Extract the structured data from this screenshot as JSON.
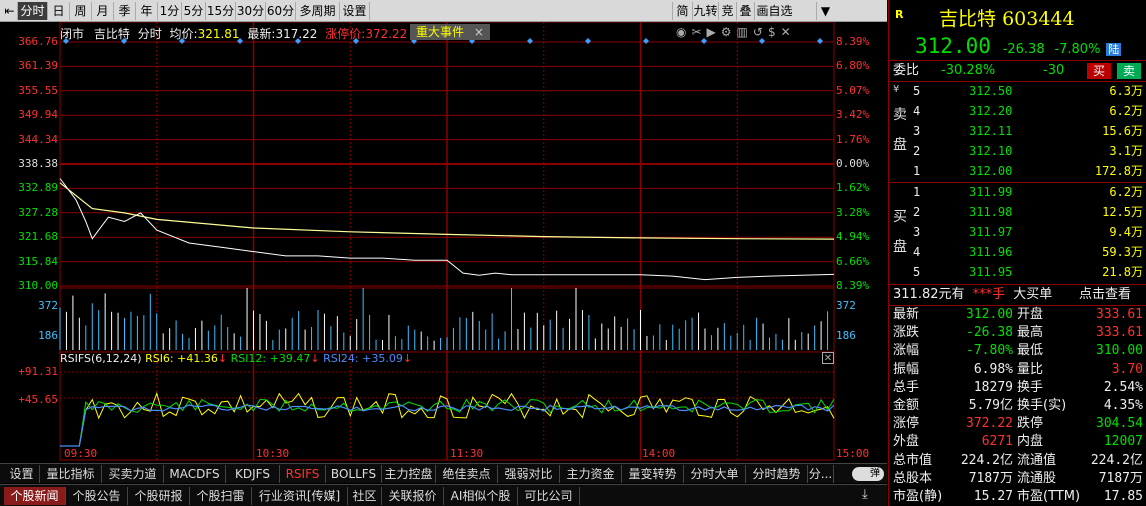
{
  "toolbar": {
    "tabs": [
      "分时",
      "日",
      "周",
      "月",
      "季",
      "年",
      "1分",
      "5分",
      "15分",
      "30分",
      "60分",
      "多周期",
      "设置"
    ],
    "active_tab": "分时",
    "right_buttons": [
      "简",
      "九转",
      "竞",
      "叠",
      "画自选"
    ]
  },
  "header": {
    "status": "闭市",
    "name": "吉比特",
    "period": "分时",
    "avg_label": "均价:",
    "avg_value": "321.81",
    "last_label": "最新:",
    "last_value": "317.22",
    "limit_label": "涨停价:",
    "limit_value": "372.22",
    "event_tag": "重大事件"
  },
  "chart": {
    "prev_close": 338.38,
    "left_ticks": [
      "366.76",
      "361.39",
      "355.55",
      "349.94",
      "344.34",
      "338.38",
      "332.89",
      "327.28",
      "321.68",
      "315.84",
      "310.00"
    ],
    "right_ticks": [
      "8.39%",
      "6.80%",
      "5.07%",
      "3.42%",
      "1.76%",
      "0.00%",
      "1.62%",
      "3.28%",
      "4.94%",
      "6.66%",
      "8.39%"
    ],
    "vol_ticks": [
      "372",
      "186"
    ],
    "rsi_label": "RSIFS(6,12,24)",
    "rsi6": "RSI6: +41.36",
    "rsi12": "RSI12: +39.47",
    "rsi24": "RSI24: +35.09",
    "rsi_ticks": [
      "+91.31",
      "+45.65"
    ],
    "time_ticks": [
      "09:30",
      "10:30",
      "11:30",
      "14:00",
      "15:00"
    ],
    "price": [
      [
        0,
        335
      ],
      [
        2,
        333
      ],
      [
        5,
        330
      ],
      [
        8,
        325
      ],
      [
        10,
        321
      ],
      [
        12,
        323
      ],
      [
        15,
        326
      ],
      [
        20,
        325
      ],
      [
        25,
        327
      ],
      [
        30,
        323
      ],
      [
        40,
        320
      ],
      [
        50,
        319
      ],
      [
        60,
        318
      ],
      [
        70,
        317
      ],
      [
        80,
        317
      ],
      [
        90,
        316.5
      ],
      [
        100,
        316.5
      ],
      [
        110,
        316
      ],
      [
        120,
        316
      ],
      [
        125,
        313
      ],
      [
        130,
        312.5
      ],
      [
        135,
        313
      ],
      [
        140,
        312.6
      ],
      [
        150,
        312.6
      ],
      [
        160,
        312.6
      ],
      [
        180,
        312.6
      ],
      [
        190,
        312.3
      ],
      [
        200,
        311.5
      ],
      [
        210,
        312
      ],
      [
        220,
        312.3
      ],
      [
        230,
        312.5
      ],
      [
        240,
        312.7
      ]
    ],
    "avg": [
      [
        0,
        334
      ],
      [
        10,
        328
      ],
      [
        20,
        327
      ],
      [
        30,
        325.5
      ],
      [
        60,
        323.5
      ],
      [
        90,
        322.6
      ],
      [
        120,
        322
      ],
      [
        150,
        321.5
      ],
      [
        180,
        321.2
      ],
      [
        210,
        321
      ],
      [
        240,
        320.9
      ]
    ]
  },
  "bottom_tabs": [
    "设置",
    "量比指标",
    "买卖力道",
    "MACDFS",
    "KDJFS",
    "RSIFS",
    "BOLLFS",
    "主力控盘",
    "绝佳卖点",
    "强弱对比",
    "主力资金",
    "量变转势",
    "分时大单",
    "分时趋势",
    "分..."
  ],
  "bottom_active": "RSIFS",
  "toggle_label": "弹",
  "news_tabs": [
    "个股新闻",
    "个股公告",
    "个股研报",
    "个股扫雷",
    "行业资讯[传媒]",
    "社区",
    "关联报价",
    "AI相似个股",
    "可比公司"
  ],
  "news_active": "个股新闻",
  "quote": {
    "badge": "R",
    "name": "吉比特",
    "code": "603444",
    "price": "312.00",
    "change": "-26.38",
    "pct": "-7.80%",
    "market": "陆",
    "wb_label": "委比",
    "wb_pct": "-30.28%",
    "wb_diff": "-30",
    "buy_btn": "买",
    "sell_btn": "卖",
    "sell_side_label": "卖盘",
    "buy_side_label": "买盘",
    "sells": [
      [
        "5",
        "312.50",
        "6.3万"
      ],
      [
        "4",
        "312.20",
        "6.2万"
      ],
      [
        "3",
        "312.11",
        "15.6万"
      ],
      [
        "2",
        "312.10",
        "3.1万"
      ],
      [
        "1",
        "312.00",
        "172.8万"
      ]
    ],
    "buys": [
      [
        "1",
        "311.99",
        "6.2万"
      ],
      [
        "2",
        "311.98",
        "12.5万"
      ],
      [
        "3",
        "311.97",
        "9.4万"
      ],
      [
        "4",
        "311.96",
        "59.3万"
      ],
      [
        "5",
        "311.95",
        "21.8万"
      ]
    ],
    "big_order": "311.82元有",
    "big_hand": "***手",
    "big_label": "大买单",
    "click_view": "点击查看",
    "stats": [
      [
        "最新",
        "312.00",
        "开盘",
        "333.61"
      ],
      [
        "涨跌",
        "-26.38",
        "最高",
        "333.61"
      ],
      [
        "涨幅",
        "-7.80%",
        "最低",
        "310.00"
      ],
      [
        "振幅",
        "6.98%",
        "量比",
        "3.70"
      ],
      [
        "总手",
        "18279",
        "换手",
        "2.54%"
      ],
      [
        "金额",
        "5.79亿",
        "换手(实)",
        "4.35%"
      ],
      [
        "涨停",
        "372.22",
        "跌停",
        "304.54"
      ],
      [
        "外盘",
        "6271",
        "内盘",
        "12007"
      ],
      [
        "总市值",
        "224.2亿",
        "流通值",
        "224.2亿"
      ],
      [
        "总股本",
        "7187万",
        "流通股",
        "7187万"
      ],
      [
        "市盈(静)",
        "15.27",
        "市盈(TTM)",
        "17.85"
      ]
    ]
  },
  "colors": {
    "up": "#ff3030",
    "down": "#00e000",
    "grid": "#8b0000",
    "price": "#ffffff",
    "avg": "#ffff99"
  }
}
